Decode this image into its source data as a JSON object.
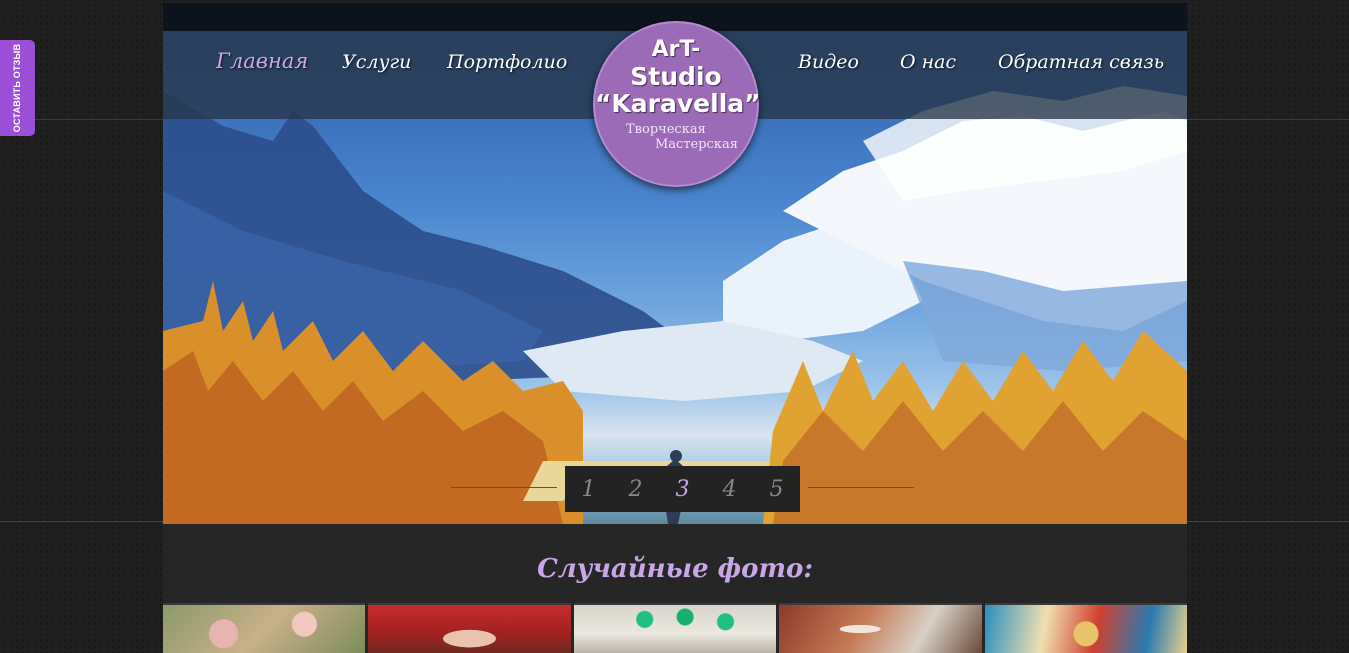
{
  "feedback_tab": {
    "label": "ОСТАВИТЬ ОТЗЫВ"
  },
  "nav": {
    "items": [
      {
        "label": "Главная",
        "active": true
      },
      {
        "label": "Услуги"
      },
      {
        "label": "Портфолио"
      },
      {
        "label": "Видео"
      },
      {
        "label": "О нас"
      },
      {
        "label": "Обратная связь"
      }
    ]
  },
  "logo": {
    "line1": "ArT-",
    "line2": "Studio",
    "line3": "“Karavella”",
    "subtitle1": "Творческая",
    "subtitle2": "Мастерская"
  },
  "slider": {
    "pages": [
      "1",
      "2",
      "3",
      "4",
      "5"
    ],
    "current_page": "3"
  },
  "random_photos": {
    "title": "Случайные фото:"
  },
  "colors": {
    "accent": "#c9a6e8",
    "logo_bg": "#9c6bb8",
    "feedback_tab": "#9b4fd6"
  }
}
